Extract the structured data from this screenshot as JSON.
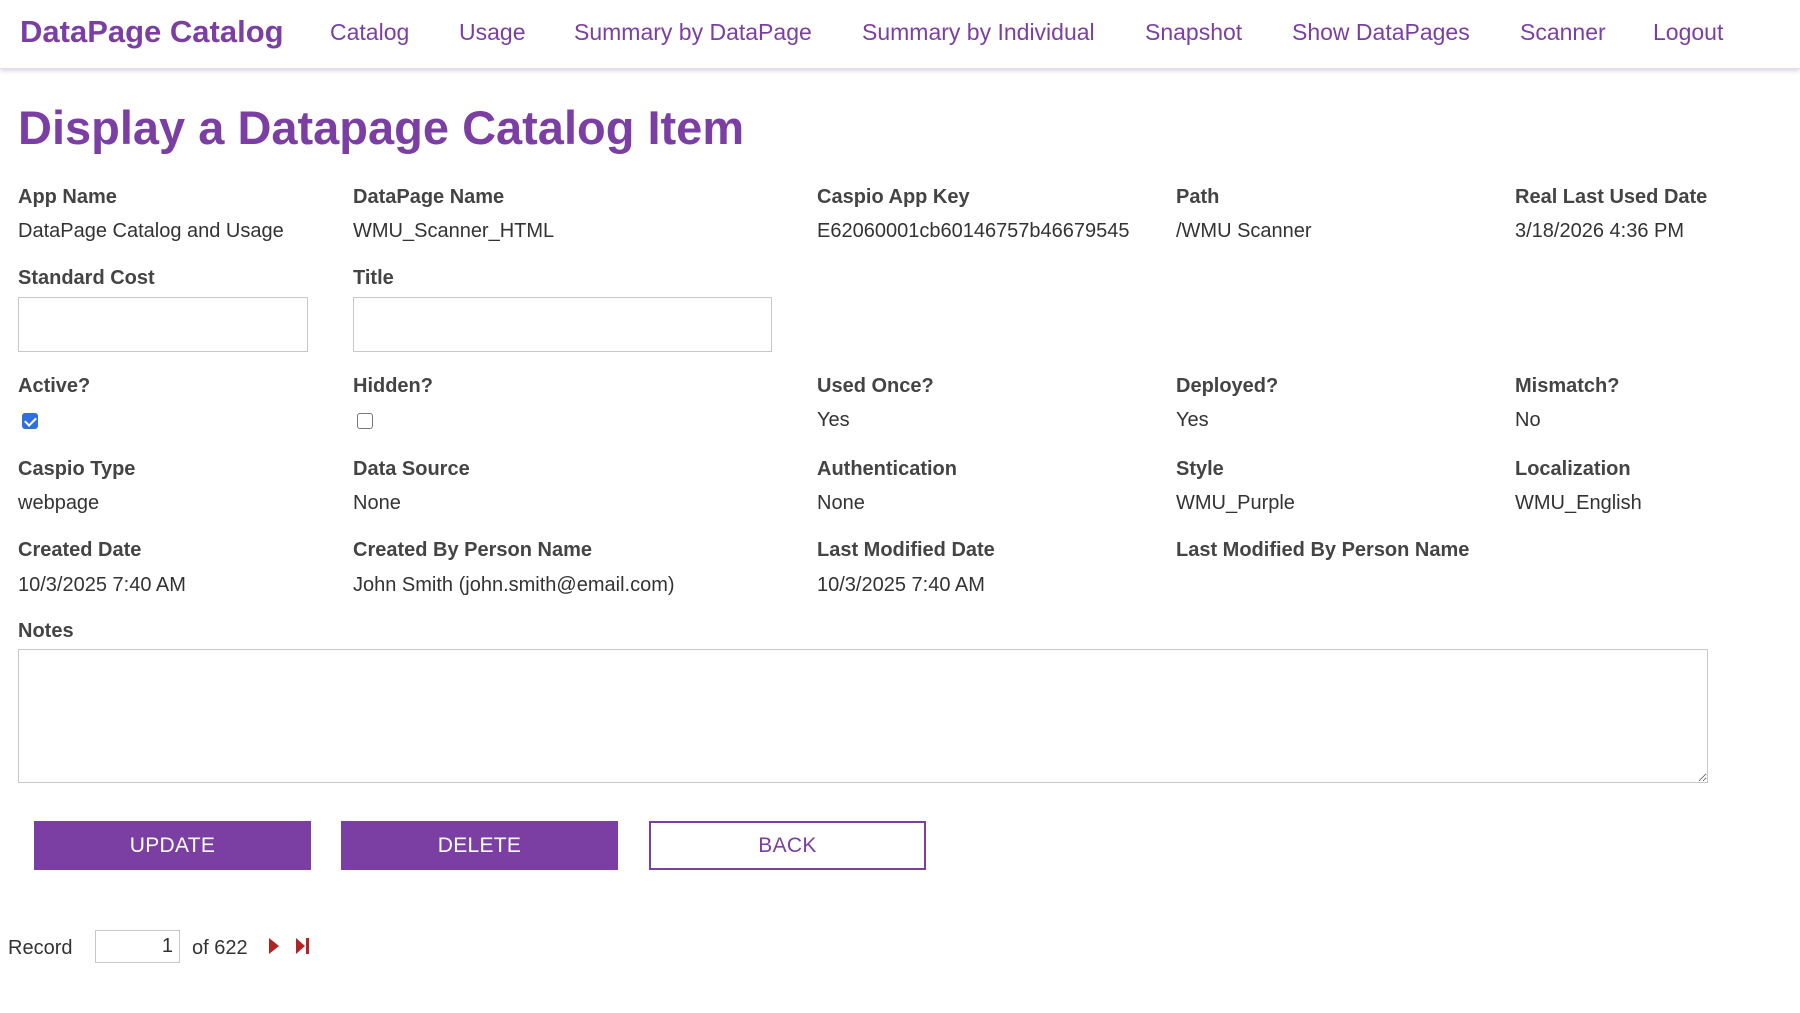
{
  "nav": {
    "brand": "DataPage Catalog",
    "links": [
      "Catalog",
      "Usage",
      "Summary by DataPage",
      "Summary by Individual",
      "Snapshot",
      "Show DataPages",
      "Scanner",
      "Logout"
    ]
  },
  "page_title": "Display a Datapage Catalog Item",
  "fields": {
    "app_name": {
      "label": "App Name",
      "value": "DataPage Catalog and Usage"
    },
    "datapage_name": {
      "label": "DataPage Name",
      "value": "WMU_Scanner_HTML"
    },
    "caspio_app_key": {
      "label": "Caspio App Key",
      "value": "E62060001cb60146757b46679545"
    },
    "path": {
      "label": "Path",
      "value": "/WMU Scanner"
    },
    "real_last_used_date": {
      "label": "Real Last Used Date",
      "value": "3/18/2026 4:36 PM"
    },
    "standard_cost": {
      "label": "Standard Cost",
      "value": ""
    },
    "title": {
      "label": "Title",
      "value": ""
    },
    "active": {
      "label": "Active?",
      "checked": true
    },
    "hidden": {
      "label": "Hidden?",
      "checked": false
    },
    "used_once": {
      "label": "Used Once?",
      "value": "Yes"
    },
    "deployed": {
      "label": "Deployed?",
      "value": "Yes"
    },
    "mismatch": {
      "label": "Mismatch?",
      "value": "No"
    },
    "caspio_type": {
      "label": "Caspio Type",
      "value": "webpage"
    },
    "data_source": {
      "label": "Data Source",
      "value": "None"
    },
    "authentication": {
      "label": "Authentication",
      "value": "None"
    },
    "style": {
      "label": "Style",
      "value": "WMU_Purple"
    },
    "localization": {
      "label": "Localization",
      "value": "WMU_English"
    },
    "created_date": {
      "label": "Created Date",
      "value": "10/3/2025 7:40 AM"
    },
    "created_by": {
      "label": "Created By Person Name",
      "value": "John Smith (john.smith@email.com)"
    },
    "last_modified_date": {
      "label": "Last Modified Date",
      "value": "10/3/2025 7:40 AM"
    },
    "last_modified_by": {
      "label": "Last Modified By Person Name",
      "value": ""
    },
    "notes": {
      "label": "Notes",
      "value": ""
    }
  },
  "buttons": {
    "update": "UPDATE",
    "delete": "DELETE",
    "back": "BACK"
  },
  "pager": {
    "record_label": "Record",
    "current": "1",
    "of_label": "of 622"
  },
  "colors": {
    "brand_purple": "#7b3fa4",
    "checkbox_blue": "#2f6fde",
    "pager_arrow": "#b22222"
  },
  "icons": {
    "next": "play-triangle-icon",
    "last": "skip-to-end-icon",
    "checked": "checkbox-checked-icon",
    "unchecked": "checkbox-empty-icon"
  }
}
